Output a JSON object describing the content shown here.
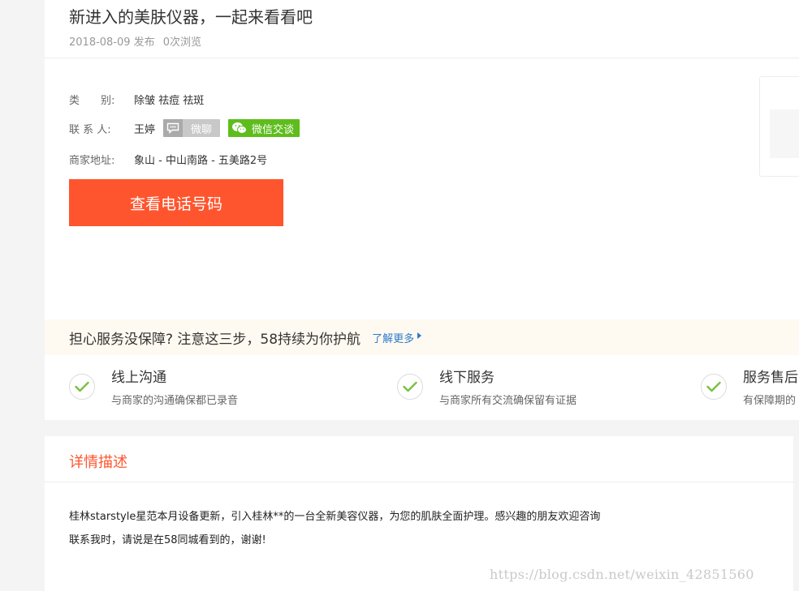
{
  "listing": {
    "title": "新进入的美肤仪器，一起来看看吧",
    "date": "2018-08-09 发布",
    "views": "0次浏览"
  },
  "info": {
    "category_label": "类　　别:",
    "category_value": "除皱 祛痘 祛斑",
    "contact_label": "联 系 人:",
    "contact_value": "王婷",
    "weiliao_label": "微聊",
    "wechat_label": "微信交谈",
    "address_label": "商家地址:",
    "address_value": "象山 -  中山南路  - 五美路2号",
    "phone_button": "查看电话号码"
  },
  "guarantee": {
    "headline": "担心服务没保障? 注意这三步，58持续为你护航",
    "more_link": "了解更多",
    "items": [
      {
        "title": "线上沟通",
        "desc": "与商家的沟通确保都已录音"
      },
      {
        "title": "线下服务",
        "desc": "与商家所有交流确保留有证据"
      },
      {
        "title": "服务售后",
        "desc": "有保障期的"
      }
    ]
  },
  "detail": {
    "heading": "详情描述",
    "line1": "桂林starstyle星范本月设备更新，引入桂林**的一台全新美容仪器，为您的肌肤全面护理。感兴趣的朋友欢迎咨询",
    "line2": "联系我时，请说是在58同城看到的，谢谢!"
  },
  "watermark": "https://blog.csdn.net/weixin_42851560",
  "colors": {
    "accent": "#ff552e",
    "wechat_green": "#5ebd1c",
    "link_blue": "#2b7acc",
    "check_green": "#7ac143"
  },
  "icons": {
    "weiliao": "chat-bubble-icon",
    "wechat": "wechat-icon",
    "check": "check-icon",
    "more": "triangle-right-icon"
  }
}
